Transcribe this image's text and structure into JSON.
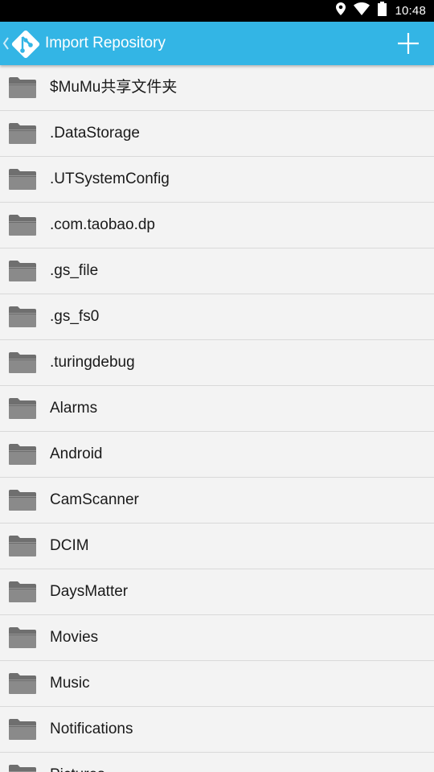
{
  "status_bar": {
    "time": "10:48",
    "icons": [
      "location-icon",
      "wifi-icon",
      "battery-icon"
    ]
  },
  "app_bar": {
    "title": "Import Repository",
    "logo_icon": "git-logo-icon",
    "action_icon": "plus-icon",
    "background": "#33b5e5"
  },
  "folders": [
    {
      "name": "$MuMu共享文件夹"
    },
    {
      "name": ".DataStorage"
    },
    {
      "name": ".UTSystemConfig"
    },
    {
      "name": ".com.taobao.dp"
    },
    {
      "name": ".gs_file"
    },
    {
      "name": ".gs_fs0"
    },
    {
      "name": ".turingdebug"
    },
    {
      "name": "Alarms"
    },
    {
      "name": "Android"
    },
    {
      "name": "CamScanner"
    },
    {
      "name": "DCIM"
    },
    {
      "name": "DaysMatter"
    },
    {
      "name": "Movies"
    },
    {
      "name": "Music"
    },
    {
      "name": "Notifications"
    },
    {
      "name": "Pictures"
    }
  ]
}
